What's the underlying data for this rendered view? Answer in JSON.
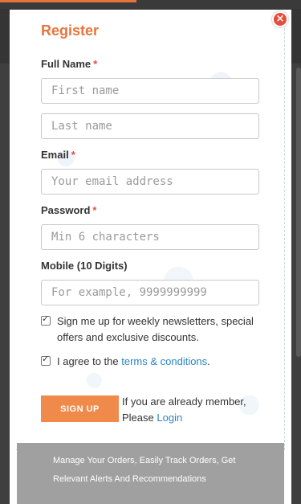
{
  "modal": {
    "title": "Register",
    "close_label": "×"
  },
  "form": {
    "full_name_label": "Full Name",
    "required_mark": "*",
    "first_name_placeholder": "First name",
    "last_name_placeholder": "Last name",
    "email_label": "Email",
    "email_placeholder": "Your email address",
    "password_label": "Password",
    "password_placeholder": "Min 6 characters",
    "mobile_label": "Mobile (10 Digits)",
    "mobile_placeholder": "For example, 9999999999",
    "newsletter_text": "Sign me up for weekly newsletters, special offers and exclusive discounts.",
    "terms_prefix": "I agree to the ",
    "terms_link": "terms & conditions",
    "terms_suffix": ".",
    "signup_label": "SIGN UP",
    "member_text": "If you are already member, Please ",
    "login_link": "Login"
  },
  "footer": {
    "text": "Manage Your Orders, Easily Track Orders, Get Relevant Alerts And Recommendations"
  },
  "colors": {
    "accent": "#e8743b",
    "link": "#2a85c9",
    "required": "#e74c3c"
  }
}
